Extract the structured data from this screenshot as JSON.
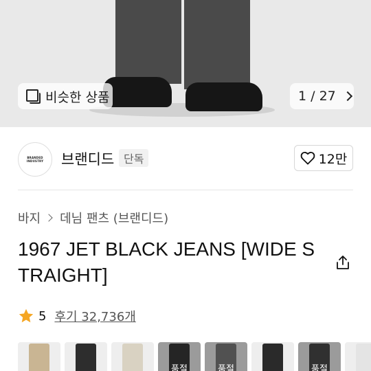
{
  "hero": {
    "similar_label": "비슷한 상품",
    "pager": "1 / 27"
  },
  "brand": {
    "logo_text": "BRANDED INDUSTRY",
    "name": "브랜디드",
    "badge": "단독",
    "likes": "12만"
  },
  "breadcrumb": {
    "items": [
      "바지",
      "데님 팬츠 (브랜디드)"
    ]
  },
  "product": {
    "title": "1967 JET BLACK JEANS [WIDE STRAIGHT]"
  },
  "rating": {
    "score": "5",
    "reviews": "후기 32,736개"
  },
  "thumbnails": [
    {
      "color": "#c9b593",
      "label": ""
    },
    {
      "color": "#2d2d2d",
      "label": ""
    },
    {
      "color": "#d9d2c2",
      "label": ""
    },
    {
      "color": "#3a3a3a",
      "label": "품절"
    },
    {
      "color": "#7d7d7d",
      "label": "품절"
    },
    {
      "color": "#2a2a2a",
      "label": ""
    },
    {
      "color": "#4a4a4a",
      "label": "품절"
    },
    {
      "color": "#e4e4e4",
      "label": ""
    }
  ],
  "colors": {
    "star": "#f5a623",
    "background": "#ffffff"
  }
}
